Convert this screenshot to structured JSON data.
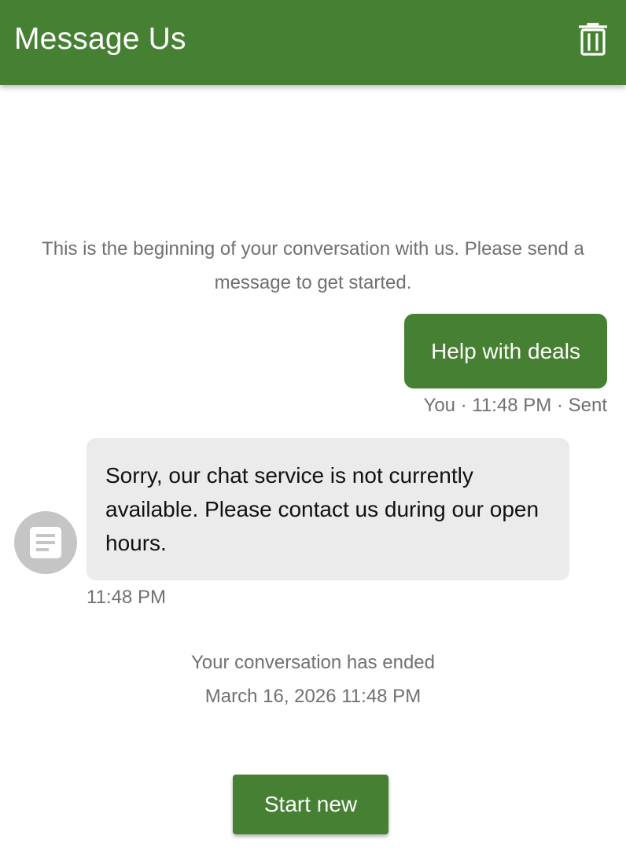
{
  "header": {
    "title": "Message Us",
    "delete_icon": "trash-icon"
  },
  "conversation": {
    "intro_text": "This is the beginning of your conversation with us. Please send a message to get started.",
    "user_message": {
      "text": "Help with deals",
      "meta": "You · 11:48 PM · Sent"
    },
    "agent_message": {
      "avatar_icon": "document-icon",
      "text": "Sorry, our chat service is not currently available. Please contact us during our open hours.",
      "time": "11:48 PM"
    },
    "ended": {
      "status": "Your conversation has ended",
      "timestamp": "March 16, 2026 11:48 PM"
    }
  },
  "actions": {
    "start_new_label": "Start new"
  },
  "colors": {
    "brand_green": "#468032",
    "agent_bubble": "#ebebeb",
    "muted_text": "#707070"
  }
}
